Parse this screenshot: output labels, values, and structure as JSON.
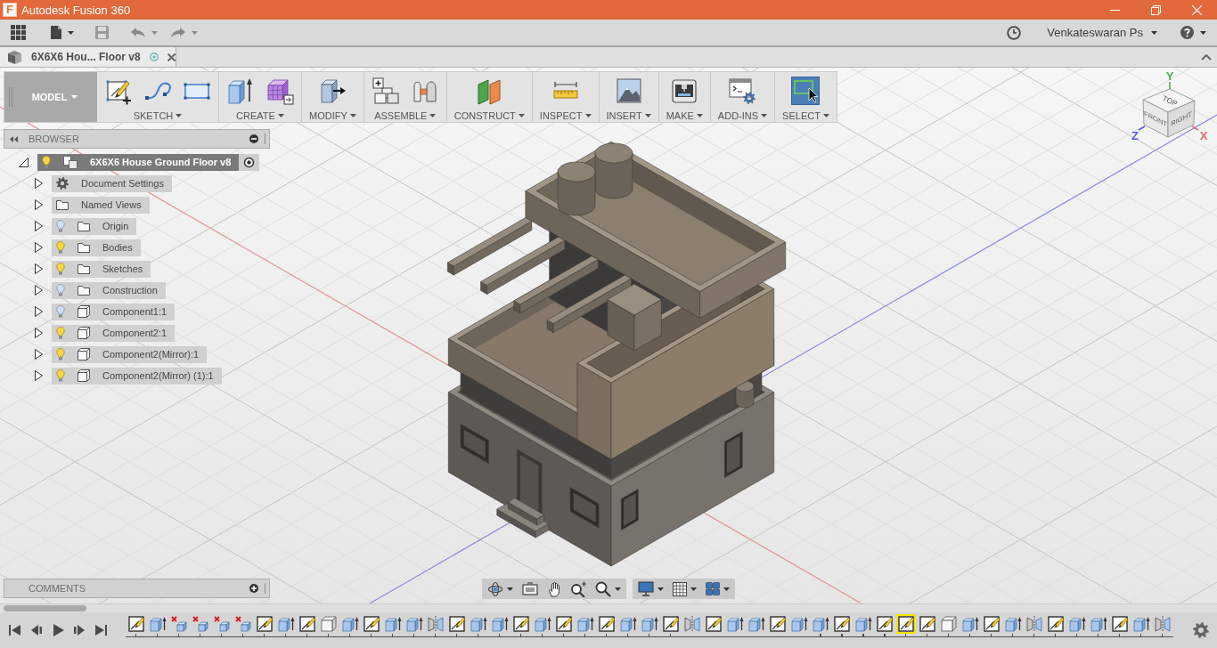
{
  "title_bar": {
    "logo": "F",
    "title": "Autodesk Fusion 360"
  },
  "header": {
    "user": "Venkateswaran Ps"
  },
  "document_tab": {
    "title": "6X6X6 Hou... Floor v8"
  },
  "toolbar": {
    "workspace": "MODEL",
    "groups": [
      {
        "label": "SKETCH",
        "tools": [
          {
            "kind": "sketch",
            "active": false
          },
          {
            "kind": "spline",
            "active": false
          },
          {
            "kind": "rectangle",
            "active": false
          }
        ]
      },
      {
        "label": "CREATE",
        "tools": [
          {
            "kind": "extrude",
            "active": false
          },
          {
            "kind": "form",
            "active": false
          }
        ]
      },
      {
        "label": "MODIFY",
        "tools": [
          {
            "kind": "press-pull",
            "active": false
          }
        ]
      },
      {
        "label": "ASSEMBLE",
        "tools": [
          {
            "kind": "component",
            "active": false
          },
          {
            "kind": "joint",
            "active": false
          }
        ]
      },
      {
        "label": "CONSTRUCT",
        "tools": [
          {
            "kind": "plane",
            "active": false
          }
        ]
      },
      {
        "label": "INSPECT",
        "tools": [
          {
            "kind": "measure",
            "active": false
          }
        ]
      },
      {
        "label": "INSERT",
        "tools": [
          {
            "kind": "image",
            "active": false
          }
        ]
      },
      {
        "label": "MAKE",
        "tools": [
          {
            "kind": "print",
            "active": false
          }
        ]
      },
      {
        "label": "ADD-INS",
        "tools": [
          {
            "kind": "script",
            "active": false
          }
        ]
      },
      {
        "label": "SELECT",
        "tools": [
          {
            "kind": "select",
            "active": true
          }
        ]
      }
    ]
  },
  "browser": {
    "title": "BROWSER",
    "root": {
      "label": "6X6X6 House Ground Floor v8",
      "kind": "root",
      "visible": true,
      "expanded": true,
      "selected": true,
      "children": [
        {
          "label": "Document Settings",
          "kind": "settings",
          "expanded": false,
          "selected": false
        },
        {
          "label": "Named Views",
          "kind": "folder",
          "expanded": false,
          "selected": false
        },
        {
          "label": "Origin",
          "kind": "folder",
          "visible": false,
          "expanded": false,
          "selected": false
        },
        {
          "label": "Bodies",
          "kind": "folder",
          "visible": true,
          "expanded": false,
          "selected": false
        },
        {
          "label": "Sketches",
          "kind": "folder",
          "visible": true,
          "expanded": false,
          "selected": false
        },
        {
          "label": "Construction",
          "kind": "folder",
          "visible": false,
          "expanded": false,
          "selected": false
        },
        {
          "label": "Component1:1",
          "kind": "component",
          "visible": false,
          "expanded": false,
          "selected": false
        },
        {
          "label": "Component2:1",
          "kind": "component",
          "visible": true,
          "expanded": false,
          "selected": false
        },
        {
          "label": "Component2(Mirror):1",
          "kind": "component",
          "visible": true,
          "expanded": false,
          "selected": false
        },
        {
          "label": "Component2(Mirror) (1):1",
          "kind": "component",
          "visible": true,
          "expanded": false,
          "selected": false
        }
      ]
    }
  },
  "comments": {
    "title": "COMMENTS"
  },
  "view_cube": {
    "faces": [
      "TOP",
      "FRONT",
      "RIGHT"
    ],
    "axes": [
      {
        "label": "X",
        "color": "#e06868"
      },
      {
        "label": "Y",
        "color": "#4caf4c"
      },
      {
        "label": "Z",
        "color": "#5a5ad8"
      }
    ]
  },
  "timeline": {
    "features": [
      {
        "kind": "sketch",
        "selected": false
      },
      {
        "kind": "extrude",
        "selected": false
      },
      {
        "kind": "delete",
        "selected": false
      },
      {
        "kind": "delete",
        "selected": false
      },
      {
        "kind": "delete",
        "selected": false
      },
      {
        "kind": "delete",
        "selected": false
      },
      {
        "kind": "sketch",
        "selected": false
      },
      {
        "kind": "extrude",
        "selected": false
      },
      {
        "kind": "sketch",
        "selected": false
      },
      {
        "kind": "box",
        "selected": false
      },
      {
        "kind": "extrude",
        "selected": false
      },
      {
        "kind": "sketch",
        "selected": false
      },
      {
        "kind": "extrude",
        "selected": false
      },
      {
        "kind": "extrude",
        "selected": false
      },
      {
        "kind": "mirror",
        "selected": false
      },
      {
        "kind": "sketch",
        "selected": false
      },
      {
        "kind": "extrude",
        "selected": false
      },
      {
        "kind": "extrude",
        "selected": false
      },
      {
        "kind": "sketch",
        "selected": false
      },
      {
        "kind": "extrude",
        "selected": false
      },
      {
        "kind": "sketch",
        "selected": false
      },
      {
        "kind": "extrude",
        "selected": false
      },
      {
        "kind": "sketch",
        "selected": false
      },
      {
        "kind": "extrude",
        "selected": false
      },
      {
        "kind": "extrude",
        "selected": false
      },
      {
        "kind": "sketch",
        "selected": false
      },
      {
        "kind": "mirror",
        "selected": false
      },
      {
        "kind": "sketch",
        "selected": false
      },
      {
        "kind": "extrude",
        "selected": false
      },
      {
        "kind": "extrude",
        "selected": false
      },
      {
        "kind": "sketch",
        "selected": false
      },
      {
        "kind": "extrude",
        "selected": false
      },
      {
        "kind": "extrude",
        "selected": false
      },
      {
        "kind": "sketch",
        "selected": false
      },
      {
        "kind": "extrude",
        "selected": false
      },
      {
        "kind": "sketch",
        "selected": false
      },
      {
        "kind": "sketch",
        "selected": true
      },
      {
        "kind": "sketch",
        "selected": false
      },
      {
        "kind": "box",
        "selected": false
      },
      {
        "kind": "extrude",
        "selected": false
      },
      {
        "kind": "sketch",
        "selected": false
      },
      {
        "kind": "extrude",
        "selected": false
      },
      {
        "kind": "mirror",
        "selected": false
      },
      {
        "kind": "sketch",
        "selected": false
      },
      {
        "kind": "extrude",
        "selected": false
      },
      {
        "kind": "extrude",
        "selected": false
      },
      {
        "kind": "sketch",
        "selected": false
      },
      {
        "kind": "extrude",
        "selected": false
      },
      {
        "kind": "mirror",
        "selected": false
      }
    ]
  }
}
